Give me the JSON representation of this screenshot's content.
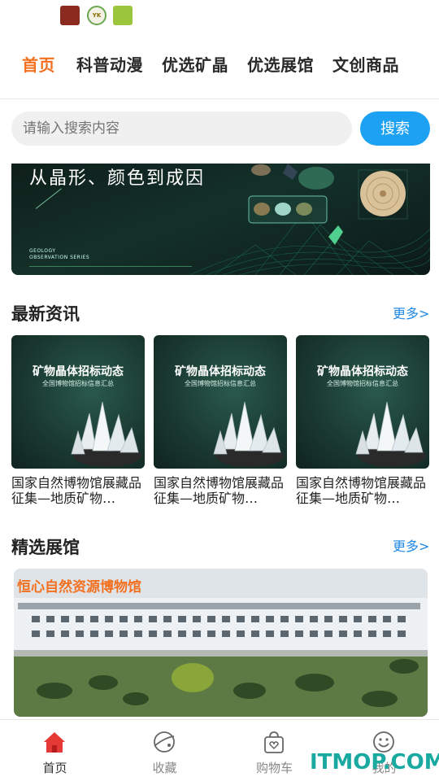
{
  "status_bar": {
    "icons": [
      "app-icon-red",
      "app-icon-yk",
      "app-icon-green"
    ],
    "icon_labels": [
      "",
      "YK",
      ""
    ]
  },
  "nav": {
    "tabs": [
      {
        "label": "首页",
        "active": true
      },
      {
        "label": "科普动漫",
        "active": false
      },
      {
        "label": "优选矿晶",
        "active": false
      },
      {
        "label": "优选展馆",
        "active": false
      },
      {
        "label": "文创商品",
        "active": false
      }
    ]
  },
  "search": {
    "placeholder": "请输入搜索内容",
    "button_label": "搜索"
  },
  "banner": {
    "title": "从晶形、颜色到成因",
    "subtitle_line1": "GEOLOGY",
    "subtitle_line2": "OBSERVATION SERIES"
  },
  "news": {
    "title": "最新资讯",
    "more_label": "更多>",
    "items": [
      {
        "image_title": "矿物晶体招标动态",
        "image_subtitle": "全国博物馆招标信息汇总",
        "text": "国家自然博物馆展藏品征集—地质矿物…"
      },
      {
        "image_title": "矿物晶体招标动态",
        "image_subtitle": "全国博物馆招标信息汇总",
        "text": "国家自然博物馆展藏品征集—地质矿物…"
      },
      {
        "image_title": "矿物晶体招标动态",
        "image_subtitle": "全国博物馆招标信息汇总",
        "text": "国家自然博物馆展藏品征集—地质矿物…"
      }
    ]
  },
  "museums": {
    "title": "精选展馆",
    "more_label": "更多>",
    "featured": {
      "name": "恒心自然资源博物馆"
    }
  },
  "tabbar": {
    "items": [
      {
        "label": "首页",
        "icon": "home-icon",
        "active": true
      },
      {
        "label": "收藏",
        "icon": "planet-icon",
        "active": false
      },
      {
        "label": "购物车",
        "icon": "shopping-bag-icon",
        "active": false
      },
      {
        "label": "我的",
        "icon": "smiley-icon",
        "active": false
      }
    ]
  },
  "watermark": "ITMOP.COM",
  "colors": {
    "accent": "#f37021",
    "link": "#1e88e5",
    "search_button": "#1da1f2",
    "home_icon": "#e53935"
  }
}
